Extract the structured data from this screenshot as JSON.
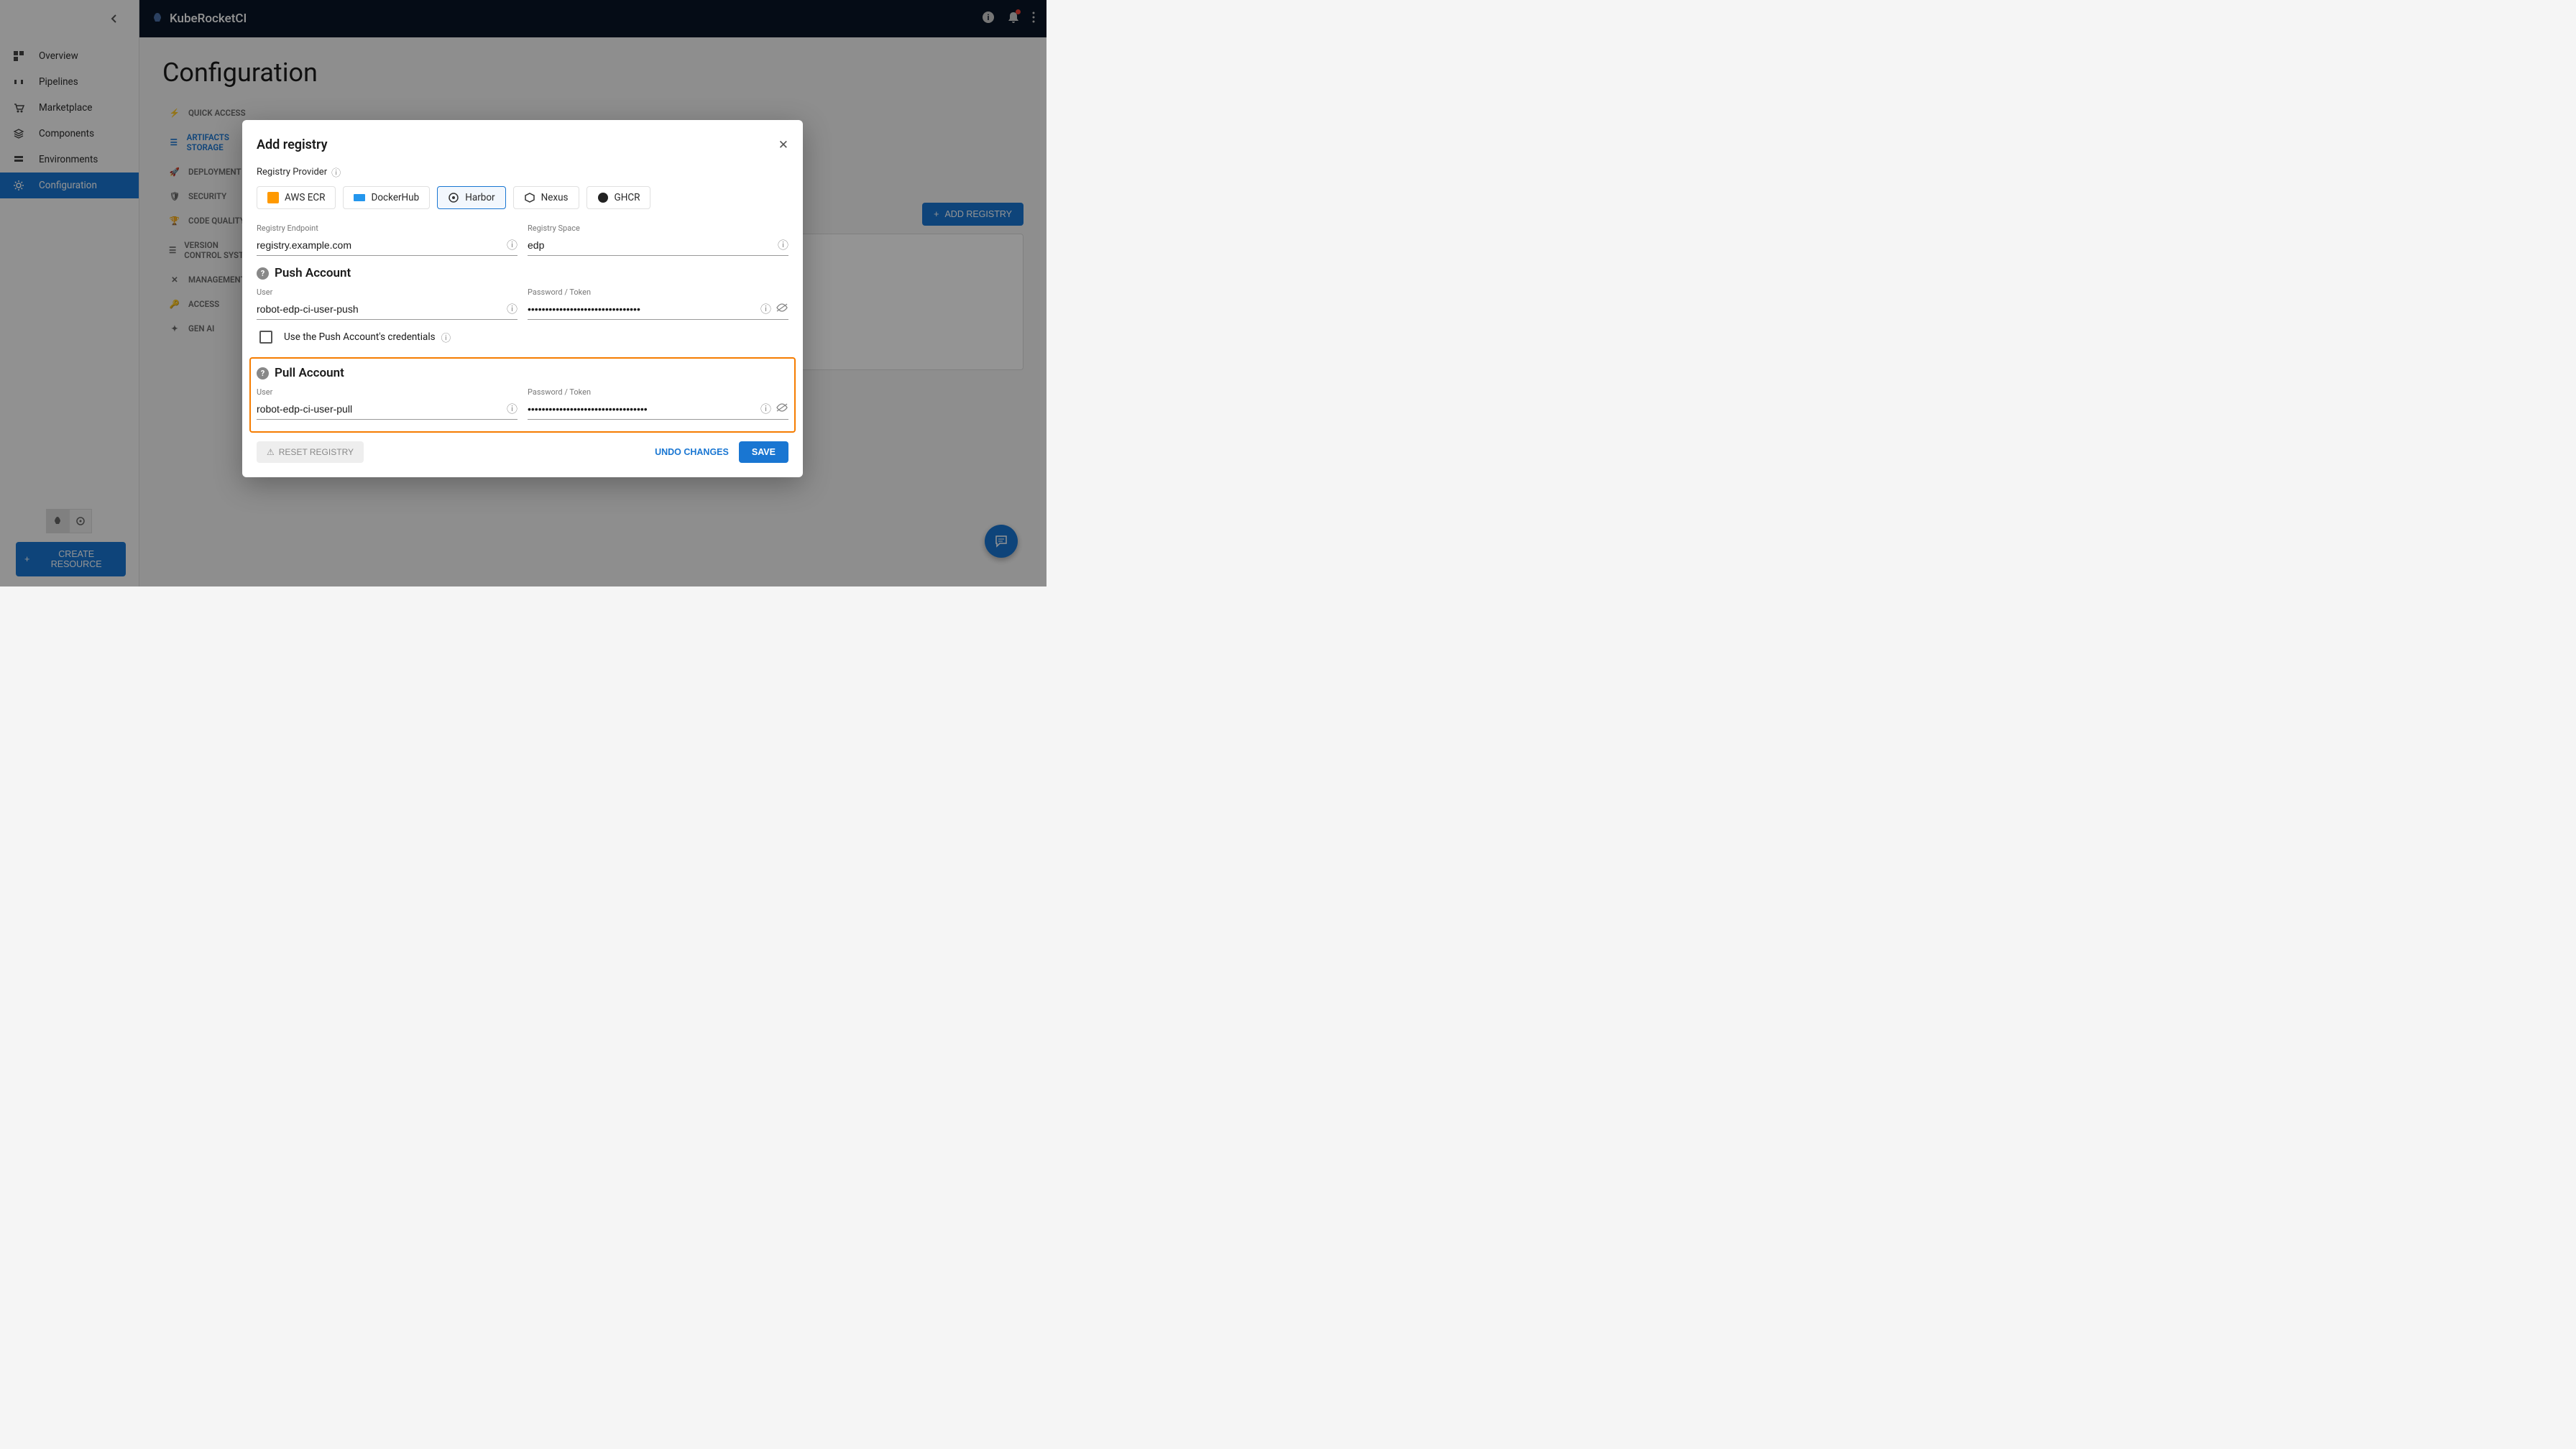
{
  "app": {
    "name": "KubeRocketCI"
  },
  "sidebar": {
    "items": [
      {
        "label": "Overview"
      },
      {
        "label": "Pipelines"
      },
      {
        "label": "Marketplace"
      },
      {
        "label": "Components"
      },
      {
        "label": "Environments"
      },
      {
        "label": "Configuration"
      }
    ],
    "create_btn": "CREATE RESOURCE"
  },
  "page": {
    "title": "Configuration",
    "add_registry_btn": "ADD REGISTRY"
  },
  "subnav": {
    "items": [
      {
        "label": "QUICK ACCESS"
      },
      {
        "label": "ARTIFACTS STORAGE"
      },
      {
        "label": "DEPLOYMENT"
      },
      {
        "label": "SECURITY"
      },
      {
        "label": "CODE QUALITY"
      },
      {
        "label": "VERSION CONTROL SYSTEM"
      },
      {
        "label": "MANAGEMENT"
      },
      {
        "label": "ACCESS"
      },
      {
        "label": "GEN AI"
      }
    ]
  },
  "dialog": {
    "title": "Add registry",
    "provider_label": "Registry Provider",
    "providers": [
      {
        "label": "AWS ECR"
      },
      {
        "label": "DockerHub"
      },
      {
        "label": "Harbor"
      },
      {
        "label": "Nexus"
      },
      {
        "label": "GHCR"
      }
    ],
    "endpoint": {
      "label": "Registry Endpoint",
      "value": "registry.example.com"
    },
    "space": {
      "label": "Registry Space",
      "value": "edp"
    },
    "push": {
      "title": "Push Account",
      "user_label": "User",
      "user_value": "robot-edp-ci-user-push",
      "pass_label": "Password / Token",
      "pass_value": "••••••••••••••••••••••••••••••••"
    },
    "use_push_checkbox": "Use the Push Account's credentials",
    "pull": {
      "title": "Pull Account",
      "user_label": "User",
      "user_value": "robot-edp-ci-user-pull",
      "pass_label": "Password / Token",
      "pass_value": "••••••••••••••••••••••••••••••••••"
    },
    "reset_btn": "RESET REGISTRY",
    "undo_btn": "UNDO CHANGES",
    "save_btn": "SAVE"
  }
}
